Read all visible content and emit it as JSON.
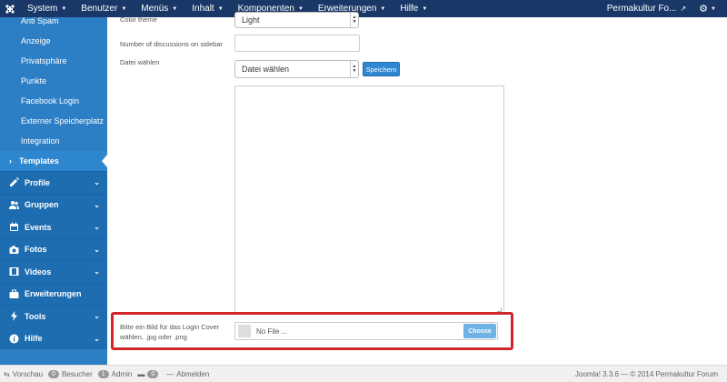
{
  "navbar": {
    "menus": [
      "System",
      "Benutzer",
      "Menüs",
      "Inhalt",
      "Komponenten",
      "Erweiterungen",
      "Hilfe"
    ],
    "site_name": "Permakultur Fo..."
  },
  "sidebar": {
    "sub_items": [
      "Anti Spam",
      "Anzeige",
      "Privatsphäre",
      "Punkte",
      "Facebook Login",
      "Externer Speicherplatz",
      "Integration"
    ],
    "active_item": "Templates",
    "sections": [
      {
        "label": "Profile",
        "icon": "edit-icon",
        "has_arrow": true
      },
      {
        "label": "Gruppen",
        "icon": "users-icon",
        "has_arrow": true
      },
      {
        "label": "Events",
        "icon": "calendar-icon",
        "has_arrow": true
      },
      {
        "label": "Fotos",
        "icon": "camera-icon",
        "has_arrow": true
      },
      {
        "label": "Videos",
        "icon": "film-icon",
        "has_arrow": true
      },
      {
        "label": "Erweiterungen",
        "icon": "briefcase-icon",
        "has_arrow": false
      },
      {
        "label": "Tools",
        "icon": "bolt-icon",
        "has_arrow": true
      },
      {
        "label": "Hilfe",
        "icon": "info-icon",
        "has_arrow": true
      }
    ]
  },
  "form": {
    "color_theme_label": "Color theme",
    "color_theme_value": "Light",
    "discussions_label": "Number of discussions on sidebar",
    "file_select_label": "Datei wählen",
    "file_select_value": "Datei wählen",
    "save_label": "Speichern",
    "cover_label": "Bitte ein Bild für das Login Cover wählen, .jpg oder .png",
    "file_placeholder": "No File ...",
    "choose_label": "Choose"
  },
  "footer": {
    "preview": "Vorschau",
    "visitors_count": "0",
    "visitors_label": "Besucher",
    "admin_count": "1",
    "admin_label": "Admin",
    "messages_count": "0",
    "logout": "Abmelden",
    "copyright": "Joomla! 3.3.6  —  © 2014 Permakultur Forum"
  },
  "colors": {
    "navbar": "#1a3867",
    "sidebar": "#2d7fc5",
    "sidebar_section": "#1e6db1",
    "primary_button": "#2f86d1",
    "highlight": "#d0262b"
  }
}
